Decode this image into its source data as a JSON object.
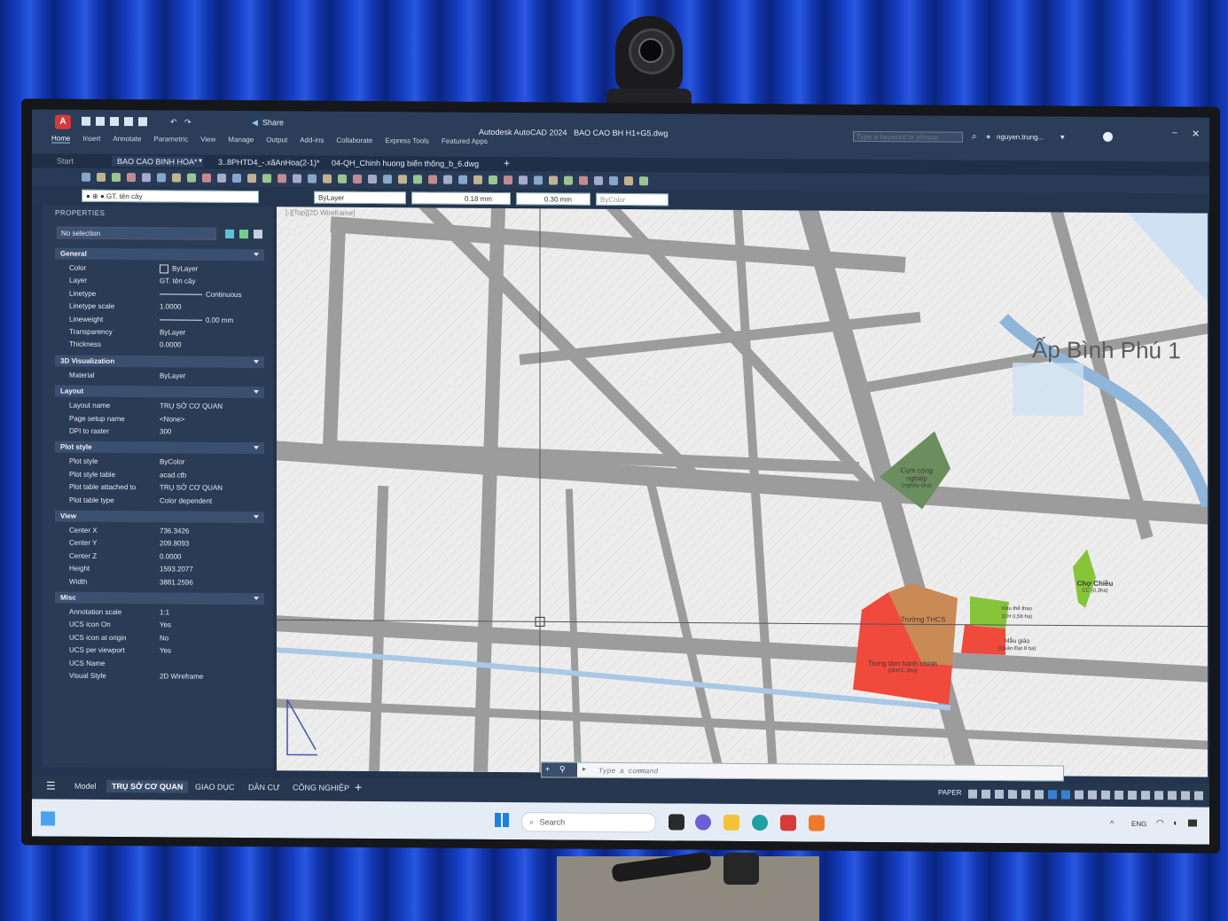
{
  "window": {
    "title": "Autodesk AutoCAD 2024",
    "file": "BAO CAO BH H1+G5.dwg",
    "share_label": "Share",
    "search_placeholder": "Type a keyword or phrase",
    "user": "nguyen.trung..."
  },
  "ribbon_tabs": [
    "Home",
    "Insert",
    "Annotate",
    "Parametric",
    "View",
    "Manage",
    "Output",
    "Add-ins",
    "Collaborate",
    "Express Tools",
    "Featured Apps"
  ],
  "doc_tabs": [
    "BAO CAO BINH HOA*",
    "3..8PHTD4_-.xãAnHoa(2-1)*",
    "04-QH_Chinh huong biến thông_b_6.dwg"
  ],
  "toolbar": {
    "layer_dropdown": "ByLayer",
    "lineweight_1": "0.18 mm",
    "lineweight_2": "0.30 mm",
    "color_dropdown": "ByColor"
  },
  "properties": {
    "header": "PROPERTIES",
    "selection": "No selection",
    "sections": [
      {
        "title": "General",
        "rows": [
          {
            "k": "Color",
            "v": "ByLayer",
            "swatch": true
          },
          {
            "k": "Layer",
            "v": "GT. tên cây"
          },
          {
            "k": "Linetype",
            "v": "Continuous",
            "line": true
          },
          {
            "k": "Linetype scale",
            "v": "1.0000"
          },
          {
            "k": "Lineweight",
            "v": "0.00 mm",
            "line": true
          },
          {
            "k": "Transparency",
            "v": "ByLayer"
          },
          {
            "k": "Thickness",
            "v": "0.0000"
          }
        ]
      },
      {
        "title": "3D Visualization",
        "rows": [
          {
            "k": "Material",
            "v": "ByLayer"
          }
        ]
      },
      {
        "title": "Layout",
        "rows": [
          {
            "k": "Layout name",
            "v": "TRỤ SỞ CƠ QUAN"
          },
          {
            "k": "Page setup name",
            "v": "<None>"
          },
          {
            "k": "DPI to raster",
            "v": "300"
          }
        ]
      },
      {
        "title": "Plot style",
        "rows": [
          {
            "k": "Plot style",
            "v": "ByColor"
          },
          {
            "k": "Plot style table",
            "v": "acad.ctb"
          },
          {
            "k": "Plot table attached to",
            "v": "TRỤ SỞ CƠ QUAN"
          },
          {
            "k": "Plot table type",
            "v": "Color dependent"
          }
        ]
      },
      {
        "title": "View",
        "rows": [
          {
            "k": "Center X",
            "v": "736.3426"
          },
          {
            "k": "Center Y",
            "v": "209.8093"
          },
          {
            "k": "Center Z",
            "v": "0.0000"
          },
          {
            "k": "Height",
            "v": "1593.2077"
          },
          {
            "k": "Width",
            "v": "3881.2596"
          }
        ]
      },
      {
        "title": "Misc",
        "rows": [
          {
            "k": "Annotation scale",
            "v": "1:1"
          },
          {
            "k": "UCS icon On",
            "v": "Yes"
          },
          {
            "k": "UCS icon at origin",
            "v": "No"
          },
          {
            "k": "UCS per viewport",
            "v": "Yes"
          },
          {
            "k": "UCS Name",
            "v": ""
          },
          {
            "k": "Visual Style",
            "v": "2D Wireframe"
          }
        ]
      }
    ]
  },
  "map": {
    "viewport_label": "[-][Top][2D Wireframe]",
    "big_label": "Ấp Bình Phú 1",
    "zones": [
      {
        "name": "Cụm công nghiệp",
        "sub": "(nghiệp 6ha)",
        "color": "#6b8e5e"
      },
      {
        "name": "Trường THCS",
        "sub": "",
        "color": "#c98a55"
      },
      {
        "name": "Trung tâm hành chính",
        "sub": "(OHCC 8ha)",
        "color": "#ef4a3c"
      },
      {
        "name": "Khu thể thao",
        "sub": "(CH 0,58 ha)",
        "color": "#86c43a"
      },
      {
        "name": "Mẫu giáo",
        "sub": "(Quản Đạt 8 ba)",
        "color": "#ef4a3c"
      },
      {
        "name": "Chợ Chiều",
        "sub": "CC (0,3ha)",
        "color": "#86c43a"
      }
    ]
  },
  "command": {
    "placeholder": "Type a command"
  },
  "status": {
    "layout_tabs": [
      "Model",
      "TRỤ SỞ CƠ QUAN",
      "GIAO DỤC",
      "DÂN CƯ",
      "CÔNG NGHIỆP"
    ],
    "active_tab": "TRỤ SỞ CƠ QUAN",
    "paper_label": "PAPER"
  },
  "taskbar": {
    "search_label": "Search",
    "lang": "ENG"
  }
}
